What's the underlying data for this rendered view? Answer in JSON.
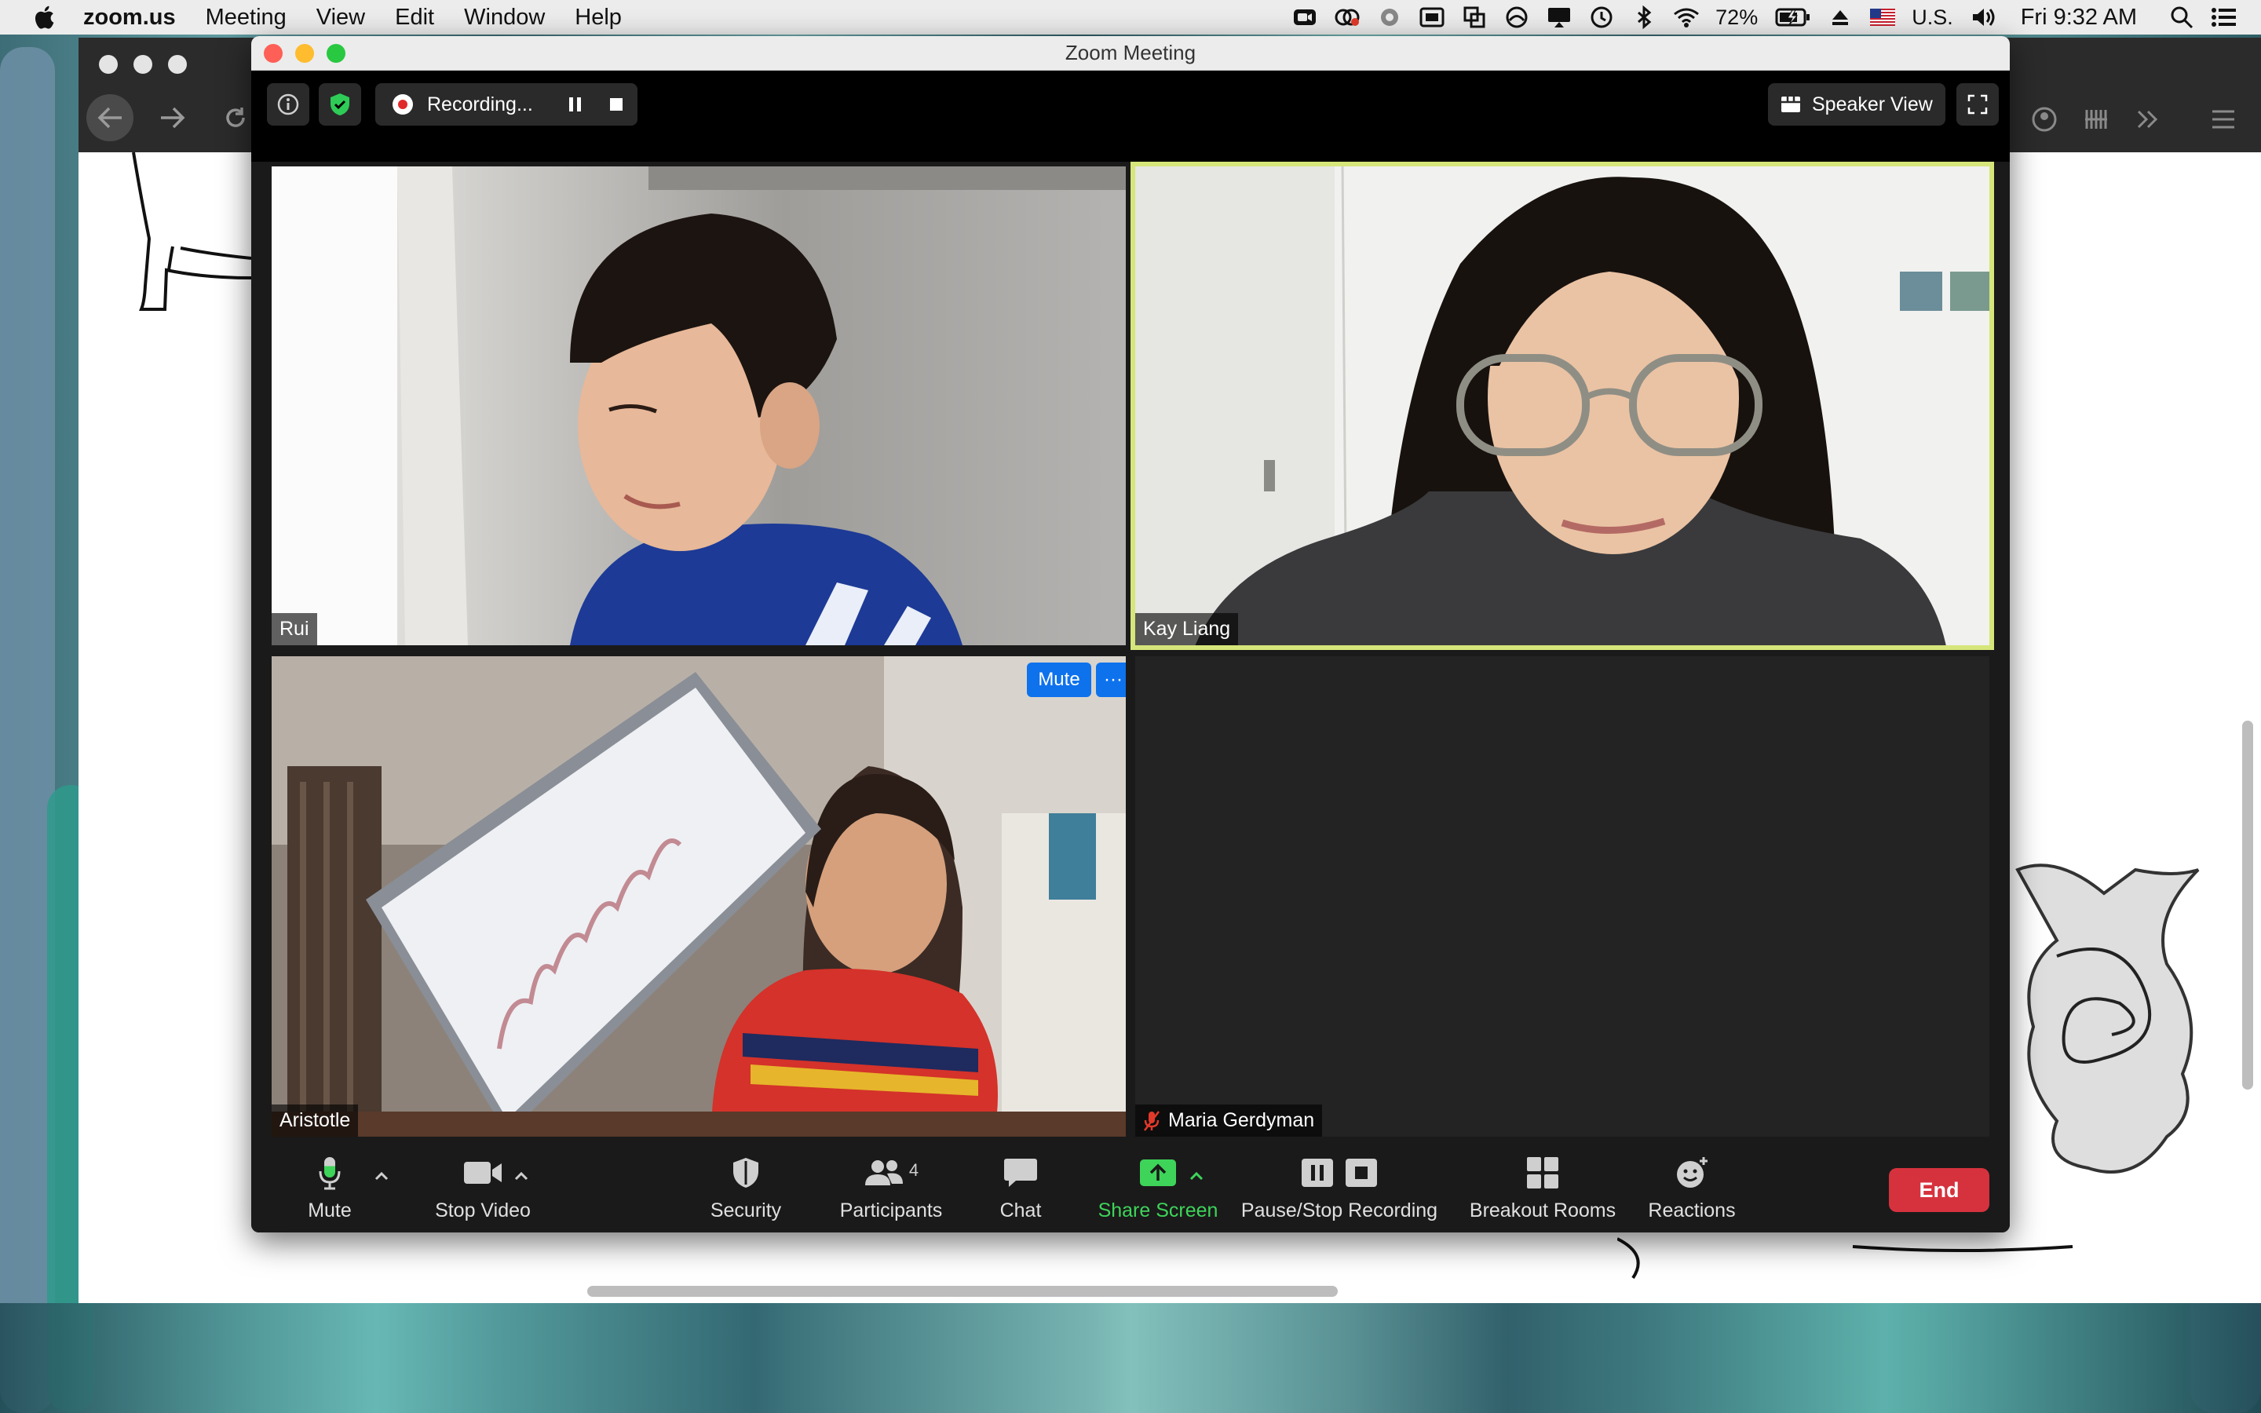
{
  "menubar": {
    "app_name": "zoom.us",
    "menus": [
      "Meeting",
      "View",
      "Edit",
      "Window",
      "Help"
    ],
    "battery": "72%",
    "input_source": "U.S.",
    "clock": "Fri 9:32 AM"
  },
  "zoom": {
    "window_title": "Zoom Meeting",
    "recording_label": "Recording...",
    "view_mode_label": "Speaker View",
    "participants": [
      {
        "name": "Rui",
        "active_speaker": false,
        "video_on": true
      },
      {
        "name": "Kay Liang",
        "active_speaker": true,
        "video_on": true
      },
      {
        "name": "Aristotle",
        "active_speaker": false,
        "video_on": true
      },
      {
        "name": "Maria Gerdyman",
        "active_speaker": false,
        "video_on": false,
        "muted": true
      }
    ],
    "tile_hover": {
      "mute_label": "Mute",
      "more_label": "···"
    },
    "toolbar": {
      "mute_label": "Mute",
      "stop_video_label": "Stop Video",
      "security_label": "Security",
      "participants_label": "Participants",
      "participants_count": "4",
      "chat_label": "Chat",
      "share_screen_label": "Share Screen",
      "recording_label": "Pause/Stop Recording",
      "breakout_label": "Breakout Rooms",
      "reactions_label": "Reactions",
      "end_label": "End"
    }
  },
  "colors": {
    "active_speaker_border": "#d6e67a",
    "share_screen_green": "#3ed45a",
    "end_red": "#d6323e",
    "zoom_blue": "#0e72ed",
    "record_red": "#e02a2a"
  }
}
